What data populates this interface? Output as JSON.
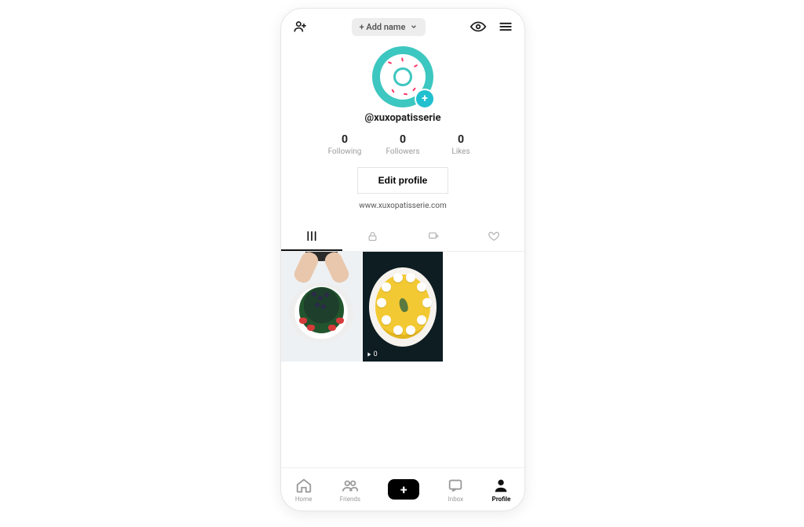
{
  "header": {
    "add_name_label": "+ Add name"
  },
  "profile": {
    "username": "@xuxopatisserie",
    "avatar_badge_glyph": "+",
    "stats": [
      {
        "count": "0",
        "label": "Following"
      },
      {
        "count": "0",
        "label": "Followers"
      },
      {
        "count": "0",
        "label": "Likes"
      }
    ],
    "edit_button": "Edit profile",
    "bio_link": "www.xuxopatisserie.com"
  },
  "content_tabs": {
    "active_index": 0
  },
  "grid": {
    "items": [
      {
        "views": null
      },
      {
        "views": "0"
      }
    ]
  },
  "nav": {
    "items": [
      {
        "label": "Home"
      },
      {
        "label": "Friends"
      },
      {
        "label": ""
      },
      {
        "label": "Inbox"
      },
      {
        "label": "Profile"
      }
    ],
    "active_index": 4,
    "create_glyph": "+"
  }
}
